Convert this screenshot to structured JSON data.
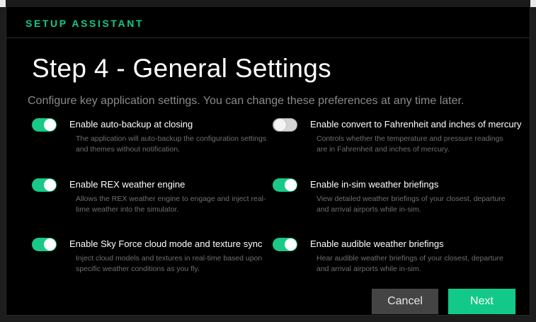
{
  "header": {
    "title": "SETUP ASSISTANT"
  },
  "main": {
    "title": "Step 4 - General Settings",
    "subtitle": "Configure key application settings. You can change these preferences at any time later."
  },
  "settings": [
    {
      "label": "Enable auto-backup at closing",
      "description": "The application will auto-backup the configuration settings and themes without notification.",
      "enabled": true
    },
    {
      "label": "Enable convert to Fahrenheit and inches of mercury",
      "description": "Controls whether the temperature and pressure readings are in Fahrenheit and inches of mercury.",
      "enabled": false
    },
    {
      "label": "Enable REX weather engine",
      "description": "Allows the REX weather engine to engage and inject real-time weather into the simulator.",
      "enabled": true
    },
    {
      "label": "Enable in-sim weather briefings",
      "description": "View detailed weather briefings of your closest, departure and arrival airports while in-sim.",
      "enabled": true
    },
    {
      "label": "Enable Sky Force cloud mode and texture sync",
      "description": "Inject cloud models and textures in real-time based upon specific weather conditions as you fly.",
      "enabled": true
    },
    {
      "label": "Enable audible weather briefings",
      "description": "Hear audible weather briefings of your closest, departure and arrival airports while in-sim.",
      "enabled": true
    }
  ],
  "buttons": {
    "cancel": "Cancel",
    "next": "Next"
  },
  "colors": {
    "accent": "#12c98a",
    "toggle_on": "#19c987",
    "toggle_off": "#d4d4d4",
    "background": "#000000"
  }
}
